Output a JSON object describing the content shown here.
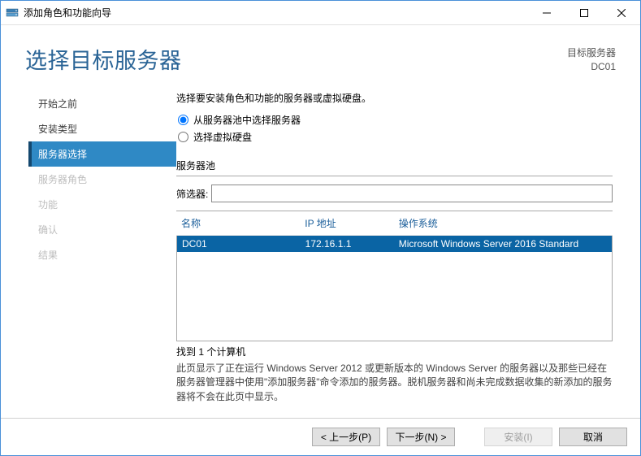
{
  "window": {
    "title": "添加角色和功能向导"
  },
  "header": {
    "page_title": "选择目标服务器",
    "target_label": "目标服务器",
    "target_value": "DC01"
  },
  "sidebar": {
    "items": [
      {
        "label": "开始之前",
        "state": "done"
      },
      {
        "label": "安装类型",
        "state": "done"
      },
      {
        "label": "服务器选择",
        "state": "active"
      },
      {
        "label": "服务器角色",
        "state": "disabled"
      },
      {
        "label": "功能",
        "state": "disabled"
      },
      {
        "label": "确认",
        "state": "disabled"
      },
      {
        "label": "结果",
        "state": "disabled"
      }
    ]
  },
  "main": {
    "instruction": "选择要安装角色和功能的服务器或虚拟硬盘。",
    "radios": {
      "option1": "从服务器池中选择服务器",
      "option2": "选择虚拟硬盘",
      "selected": "option1"
    },
    "pool_label": "服务器池",
    "filter_label": "筛选器:",
    "filter_value": "",
    "columns": {
      "name": "名称",
      "ip": "IP 地址",
      "os": "操作系统"
    },
    "rows": [
      {
        "name": "DC01",
        "ip": "172.16.1.1",
        "os": "Microsoft Windows Server 2016 Standard",
        "selected": true
      }
    ],
    "found_text": "找到 1 个计算机",
    "help_text": "此页显示了正在运行 Windows Server 2012 或更新版本的 Windows Server 的服务器以及那些已经在服务器管理器中使用\"添加服务器\"命令添加的服务器。脱机服务器和尚未完成数据收集的新添加的服务器将不会在此页中显示。"
  },
  "footer": {
    "prev": "< 上一步(P)",
    "next": "下一步(N) >",
    "install": "安装(I)",
    "cancel": "取消"
  }
}
